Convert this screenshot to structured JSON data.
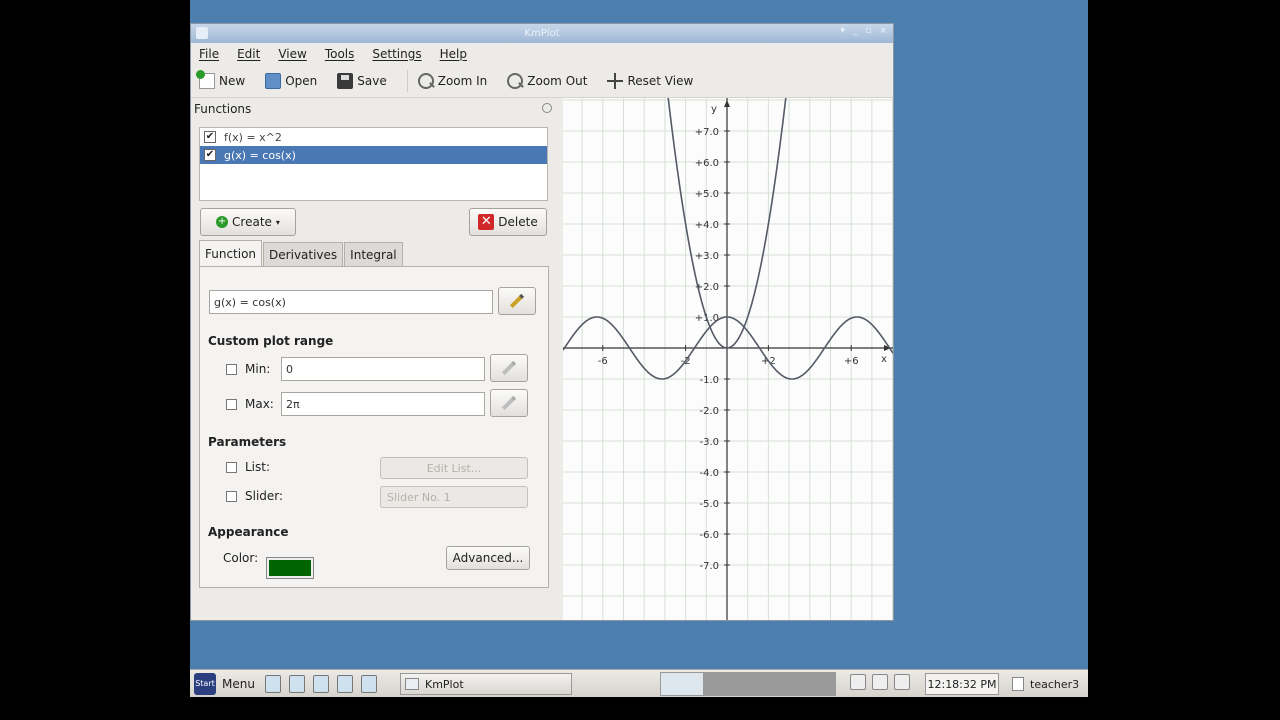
{
  "window": {
    "title": "KmPlot",
    "controls": [
      "▾",
      "_",
      "▫",
      "×"
    ]
  },
  "menu": [
    "File",
    "Edit",
    "View",
    "Tools",
    "Settings",
    "Help"
  ],
  "toolbar": {
    "new": "New",
    "open": "Open",
    "save": "Save",
    "zoom_in": "Zoom In",
    "zoom_out": "Zoom Out",
    "reset_view": "Reset View"
  },
  "functions_panel": {
    "header": "Functions",
    "items": [
      {
        "label": "f(x) = x^2",
        "checked": true,
        "selected": false
      },
      {
        "label": "g(x) = cos(x)",
        "checked": true,
        "selected": true
      }
    ],
    "create_label": "Create",
    "delete_label": "Delete"
  },
  "tabs": [
    "Function",
    "Derivatives",
    "Integral"
  ],
  "function_tab": {
    "equation": "g(x) = cos(x)",
    "custom_plot_range_title": "Custom plot range",
    "min_label": "Min:",
    "min_value": "0",
    "max_label": "Max:",
    "max_value": "2π",
    "parameters_title": "Parameters",
    "list_label": "List:",
    "edit_list_label": "Edit List...",
    "slider_label": "Slider:",
    "slider_value": "Slider No. 1",
    "appearance_title": "Appearance",
    "color_label": "Color:",
    "color_value": "#006400",
    "advanced_label": "Advanced..."
  },
  "plot": {
    "x_axis_label": "x",
    "y_axis_label": "y",
    "x_ticks": [
      "-6",
      "-2",
      "+2",
      "+6"
    ],
    "y_ticks": [
      "+7.0",
      "+6.0",
      "+5.0",
      "+4.0",
      "+3.0",
      "+2.0",
      "+1.0",
      "-1.0",
      "-2.0",
      "-3.0",
      "-4.0",
      "-5.0",
      "-6.0",
      "-7.0"
    ],
    "functions": [
      "x^2",
      "cos(x)"
    ],
    "xlim": [
      -8,
      8
    ],
    "ylim": [
      -8,
      8
    ],
    "curve_color": "#555a66",
    "grid_color": "#d7e0d7"
  },
  "taskbar": {
    "menu_label": "Menu",
    "task_label": "KmPlot",
    "clock": "12:18:32 PM",
    "user": "teacher3"
  }
}
